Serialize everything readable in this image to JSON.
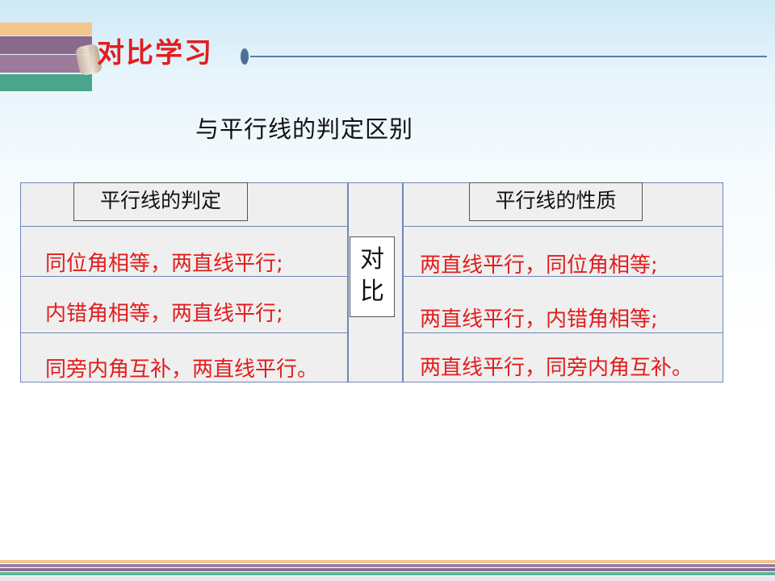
{
  "slide": {
    "title": "对比学习",
    "heading": "与平行线的判定区别",
    "left_header": "平行线的判定",
    "right_header": "平行线的性质",
    "compare_label": [
      "对",
      "比"
    ],
    "left_rows": [
      "同位角相等，两直线平行;",
      "内错角相等，两直线平行;",
      "同旁内角互补，两直线平行。"
    ],
    "right_rows": [
      "两直线平行，同位角相等;",
      "两直线平行，内错角相等;",
      "两直线平行，同旁内角互补。"
    ]
  },
  "colors": {
    "title_red": "#e21d1d",
    "row_red": "#e21d1d",
    "panel_border": "#6f86b8",
    "panel_fill": "#efefef"
  }
}
